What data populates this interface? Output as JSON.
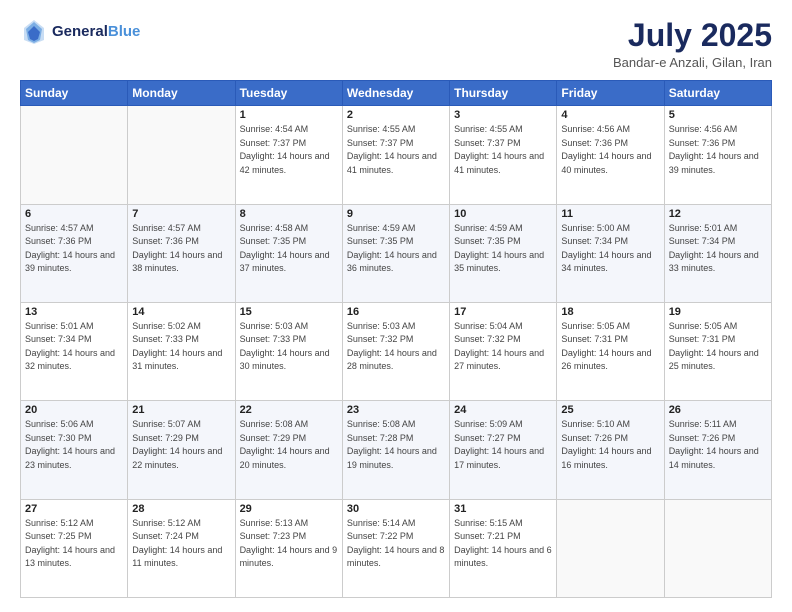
{
  "header": {
    "logo_line1": "General",
    "logo_line2": "Blue",
    "month": "July 2025",
    "location": "Bandar-e Anzali, Gilan, Iran"
  },
  "weekdays": [
    "Sunday",
    "Monday",
    "Tuesday",
    "Wednesday",
    "Thursday",
    "Friday",
    "Saturday"
  ],
  "days": [
    {
      "date": "",
      "info": ""
    },
    {
      "date": "",
      "info": ""
    },
    {
      "date": "1",
      "sunrise": "4:54 AM",
      "sunset": "7:37 PM",
      "daylight": "14 hours and 42 minutes."
    },
    {
      "date": "2",
      "sunrise": "4:55 AM",
      "sunset": "7:37 PM",
      "daylight": "14 hours and 41 minutes."
    },
    {
      "date": "3",
      "sunrise": "4:55 AM",
      "sunset": "7:37 PM",
      "daylight": "14 hours and 41 minutes."
    },
    {
      "date": "4",
      "sunrise": "4:56 AM",
      "sunset": "7:36 PM",
      "daylight": "14 hours and 40 minutes."
    },
    {
      "date": "5",
      "sunrise": "4:56 AM",
      "sunset": "7:36 PM",
      "daylight": "14 hours and 39 minutes."
    },
    {
      "date": "6",
      "sunrise": "4:57 AM",
      "sunset": "7:36 PM",
      "daylight": "14 hours and 39 minutes."
    },
    {
      "date": "7",
      "sunrise": "4:57 AM",
      "sunset": "7:36 PM",
      "daylight": "14 hours and 38 minutes."
    },
    {
      "date": "8",
      "sunrise": "4:58 AM",
      "sunset": "7:35 PM",
      "daylight": "14 hours and 37 minutes."
    },
    {
      "date": "9",
      "sunrise": "4:59 AM",
      "sunset": "7:35 PM",
      "daylight": "14 hours and 36 minutes."
    },
    {
      "date": "10",
      "sunrise": "4:59 AM",
      "sunset": "7:35 PM",
      "daylight": "14 hours and 35 minutes."
    },
    {
      "date": "11",
      "sunrise": "5:00 AM",
      "sunset": "7:34 PM",
      "daylight": "14 hours and 34 minutes."
    },
    {
      "date": "12",
      "sunrise": "5:01 AM",
      "sunset": "7:34 PM",
      "daylight": "14 hours and 33 minutes."
    },
    {
      "date": "13",
      "sunrise": "5:01 AM",
      "sunset": "7:34 PM",
      "daylight": "14 hours and 32 minutes."
    },
    {
      "date": "14",
      "sunrise": "5:02 AM",
      "sunset": "7:33 PM",
      "daylight": "14 hours and 31 minutes."
    },
    {
      "date": "15",
      "sunrise": "5:03 AM",
      "sunset": "7:33 PM",
      "daylight": "14 hours and 30 minutes."
    },
    {
      "date": "16",
      "sunrise": "5:03 AM",
      "sunset": "7:32 PM",
      "daylight": "14 hours and 28 minutes."
    },
    {
      "date": "17",
      "sunrise": "5:04 AM",
      "sunset": "7:32 PM",
      "daylight": "14 hours and 27 minutes."
    },
    {
      "date": "18",
      "sunrise": "5:05 AM",
      "sunset": "7:31 PM",
      "daylight": "14 hours and 26 minutes."
    },
    {
      "date": "19",
      "sunrise": "5:05 AM",
      "sunset": "7:31 PM",
      "daylight": "14 hours and 25 minutes."
    },
    {
      "date": "20",
      "sunrise": "5:06 AM",
      "sunset": "7:30 PM",
      "daylight": "14 hours and 23 minutes."
    },
    {
      "date": "21",
      "sunrise": "5:07 AM",
      "sunset": "7:29 PM",
      "daylight": "14 hours and 22 minutes."
    },
    {
      "date": "22",
      "sunrise": "5:08 AM",
      "sunset": "7:29 PM",
      "daylight": "14 hours and 20 minutes."
    },
    {
      "date": "23",
      "sunrise": "5:08 AM",
      "sunset": "7:28 PM",
      "daylight": "14 hours and 19 minutes."
    },
    {
      "date": "24",
      "sunrise": "5:09 AM",
      "sunset": "7:27 PM",
      "daylight": "14 hours and 17 minutes."
    },
    {
      "date": "25",
      "sunrise": "5:10 AM",
      "sunset": "7:26 PM",
      "daylight": "14 hours and 16 minutes."
    },
    {
      "date": "26",
      "sunrise": "5:11 AM",
      "sunset": "7:26 PM",
      "daylight": "14 hours and 14 minutes."
    },
    {
      "date": "27",
      "sunrise": "5:12 AM",
      "sunset": "7:25 PM",
      "daylight": "14 hours and 13 minutes."
    },
    {
      "date": "28",
      "sunrise": "5:12 AM",
      "sunset": "7:24 PM",
      "daylight": "14 hours and 11 minutes."
    },
    {
      "date": "29",
      "sunrise": "5:13 AM",
      "sunset": "7:23 PM",
      "daylight": "14 hours and 9 minutes."
    },
    {
      "date": "30",
      "sunrise": "5:14 AM",
      "sunset": "7:22 PM",
      "daylight": "14 hours and 8 minutes."
    },
    {
      "date": "31",
      "sunrise": "5:15 AM",
      "sunset": "7:21 PM",
      "daylight": "14 hours and 6 minutes."
    }
  ]
}
